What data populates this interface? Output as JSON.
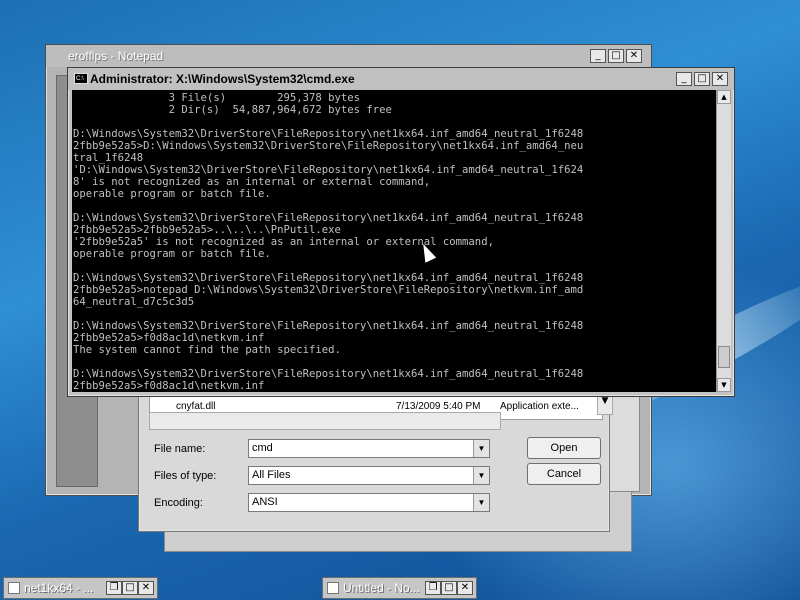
{
  "notepad": {
    "title": "erofflps - Notepad"
  },
  "cmd": {
    "title": "Administrator: X:\\Windows\\System32\\cmd.exe",
    "lines": [
      "               3 File(s)        295,378 bytes",
      "               2 Dir(s)  54,887,964,672 bytes free",
      "",
      "D:\\Windows\\System32\\DriverStore\\FileRepository\\net1kx64.inf_amd64_neutral_1f6248",
      "2fbb9e52a5>D:\\Windows\\System32\\DriverStore\\FileRepository\\net1kx64.inf_amd64_neu",
      "tral_1f6248",
      "'D:\\Windows\\System32\\DriverStore\\FileRepository\\net1kx64.inf_amd64_neutral_1f624",
      "8' is not recognized as an internal or external command,",
      "operable program or batch file.",
      "",
      "D:\\Windows\\System32\\DriverStore\\FileRepository\\net1kx64.inf_amd64_neutral_1f6248",
      "2fbb9e52a5>2fbb9e52a5>..\\..\\..\\PnPutil.exe",
      "'2fbb9e52a5' is not recognized as an internal or external command,",
      "operable program or batch file.",
      "",
      "D:\\Windows\\System32\\DriverStore\\FileRepository\\net1kx64.inf_amd64_neutral_1f6248",
      "2fbb9e52a5>notepad D:\\Windows\\System32\\DriverStore\\FileRepository\\netkvm.inf_amd",
      "64_neutral_d7c5c3d5",
      "",
      "D:\\Windows\\System32\\DriverStore\\FileRepository\\net1kx64.inf_amd64_neutral_1f6248",
      "2fbb9e52a5>f0d8ac1d\\netkvm.inf",
      "The system cannot find the path specified.",
      "",
      "D:\\Windows\\System32\\DriverStore\\FileRepository\\net1kx64.inf_amd64_neutral_1f6248",
      "2fbb9e52a5>f0d8ac1d\\netkvm.inf"
    ]
  },
  "dialog": {
    "file_row": {
      "name": "cnyfat.dll",
      "date": "7/13/2009 5:40 PM",
      "type": "Application exte..."
    },
    "file_name_label": "File name:",
    "file_name_value": "cmd",
    "files_of_type_label": "Files of type:",
    "files_of_type_value": "All Files",
    "encoding_label": "Encoding:",
    "encoding_value": "ANSI",
    "open_label": "Open",
    "cancel_label": "Cancel"
  },
  "taskbar": {
    "left_title": "net1kx64 - ...",
    "right_title": "Untitled - No..."
  },
  "controls": {
    "minimize": "_",
    "maximize": "□",
    "close": "✕",
    "restore": "❐"
  }
}
